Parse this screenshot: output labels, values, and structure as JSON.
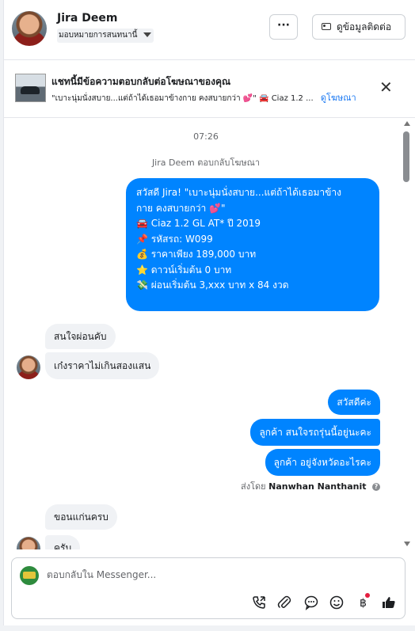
{
  "header": {
    "contact_name": "Jira Deem",
    "assign_label": "มอบหมายการสนทนานี้",
    "more_label": "···",
    "contact_info_label": "ดูข้อมูลติดต่อ"
  },
  "ad_banner": {
    "title": "แชทนี้มีข้อความตอบกลับต่อโฆษณาของคุณ",
    "preview": "\"เบาะนุ่มนั่งสบาย...แต่ถ้าได้เธอมาข้างกาย คงสบายกว่า 💕\" 🚘 Ciaz 1.2 ...",
    "view_ad_label": "ดูโฆษณา",
    "close_label": "✕"
  },
  "conversation": {
    "timestamp": "07:26",
    "replied_note": "Jira Deem ตอบกลับโฆษณา",
    "ad_message_lines": [
      "สวัสดี Jira! \"เบาะนุ่มนั่งสบาย...แต่ถ้าได้เธอมาข้าง",
      "กาย คงสบายกว่า 💕\"",
      "🚘 Ciaz 1.2 GL AT* ปี 2019",
      "",
      "📌 รหัสรถ: W099",
      "💰 ราคาเพียง 189,000 บาท",
      "⭐ ดาวน์เริ่มต้น 0 บาท",
      "💸 ผ่อนเริ่มต้น 3,xxx บาท x 84 งวด"
    ],
    "incoming_1": "สนใจผ่อนคับ",
    "incoming_2": "เก๋งราคาไม่เกินสองแสน",
    "outgoing_1": "สวัสดีค่ะ",
    "outgoing_2": "ลูกค้า สนใจรถรุ่นนี้อยู่นะคะ",
    "outgoing_3": "ลูกค้า อยู่จังหวัดอะไรคะ",
    "sent_by_prefix": "ส่งโดย",
    "sent_by_name": "Nanwhan Nanthanit",
    "incoming_3": "ขอนแก่นครบ",
    "incoming_4": "ครับ"
  },
  "composer": {
    "placeholder": "ตอบกลับใน Messenger..."
  },
  "colors": {
    "outgoing_bubble": "#0084ff",
    "incoming_bubble": "#f0f2f5",
    "link": "#1877f2",
    "notification_dot": "#e41e3f"
  },
  "icons": [
    "more-icon",
    "contact-card-icon",
    "close-icon",
    "info-icon",
    "call-icon",
    "attachment-icon",
    "saved-reply-icon",
    "emoji-icon",
    "baht-icon",
    "like-icon"
  ]
}
